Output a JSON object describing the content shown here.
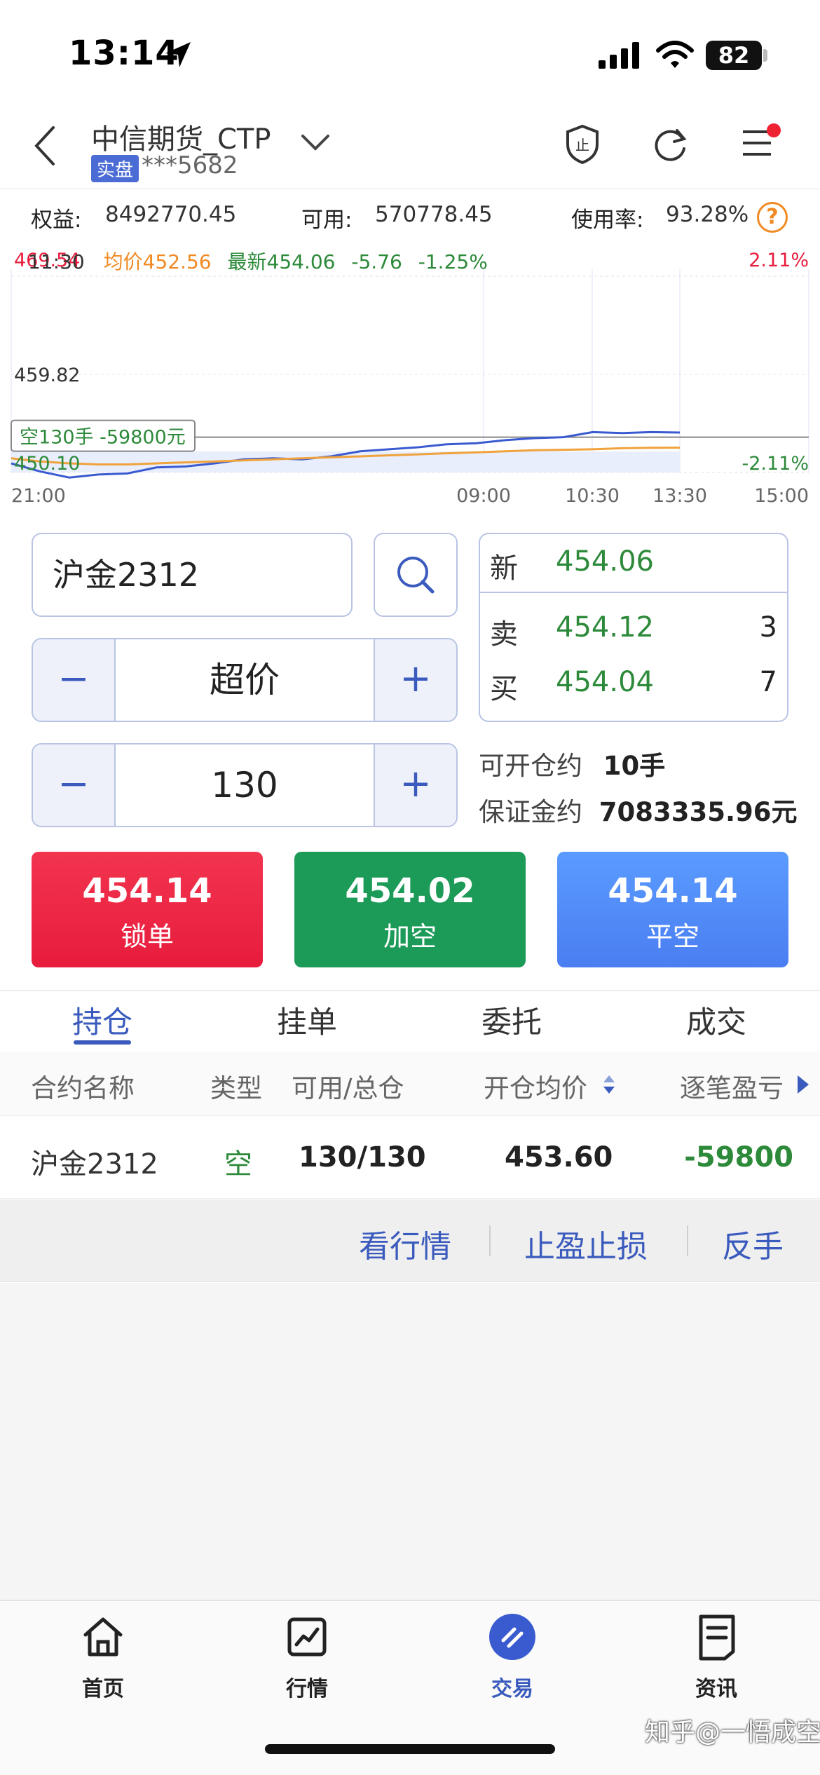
{
  "status_bar": {
    "time": "13:14",
    "battery": "82"
  },
  "header": {
    "account_name": "中信期货_CTP",
    "badge": "实盘",
    "account_no": "***5682"
  },
  "summary": {
    "equity_label": "权益:",
    "equity_value": "8492770.45",
    "available_label": "可用:",
    "available_value": "570778.45",
    "usage_label": "使用率:",
    "usage_value": "93.28%",
    "help": "?"
  },
  "chart": {
    "time": "11:30",
    "avg_label": "均价452.56",
    "last_label": "最新454.06",
    "change": "-5.76",
    "change_pct": "-1.25%",
    "y_high": "469.54",
    "y_mid": "459.82",
    "y_low": "450.10",
    "pct_high": "2.11%",
    "pct_low": "-2.11%",
    "position_tag": "空130手 -59800元",
    "x_ticks": [
      "21:00",
      "09:00",
      "10:30",
      "13:30",
      "15:00"
    ]
  },
  "chart_data": {
    "type": "line",
    "x_ticks": [
      "21:00",
      "09:00",
      "10:30",
      "13:30",
      "15:00"
    ],
    "ylim": [
      450.1,
      469.54
    ],
    "y_ticks": [
      469.54,
      459.82,
      450.1
    ],
    "percent_ticks": [
      "2.11%",
      "-2.11%"
    ],
    "reference_price": 453.6,
    "series": [
      {
        "name": "最新",
        "color": "#3a5bd0",
        "values": [
          451.0,
          450.2,
          449.6,
          449.9,
          450.0,
          450.6,
          450.7,
          451.0,
          451.4,
          451.5,
          451.4,
          451.7,
          452.2,
          452.4,
          452.6,
          452.9,
          453.0,
          453.3,
          453.5,
          453.6,
          454.1,
          454.0,
          454.1,
          454.06
        ]
      },
      {
        "name": "均价",
        "color": "#f0a23c",
        "values": [
          451.5,
          451.2,
          451.0,
          450.9,
          450.9,
          451.0,
          451.1,
          451.2,
          451.3,
          451.4,
          451.5,
          451.6,
          451.7,
          451.8,
          451.9,
          452.0,
          452.1,
          452.2,
          452.3,
          452.35,
          452.4,
          452.5,
          452.55,
          452.56
        ]
      }
    ]
  },
  "order": {
    "contract": "沪金2312",
    "price_type": "超价",
    "quantity": "130",
    "minus": "−",
    "plus": "+",
    "quote": {
      "last_label": "新",
      "last_value": "454.06",
      "ask_label": "卖",
      "ask_value": "454.12",
      "ask_vol": "3",
      "bid_label": "买",
      "bid_value": "454.04",
      "bid_vol": "7"
    },
    "open_label": "可开仓约",
    "open_value": "10手",
    "margin_label": "保证金约",
    "margin_value": "7083335.96元"
  },
  "actions": {
    "lock": {
      "price": "454.14",
      "label": "锁单"
    },
    "add_short": {
      "price": "454.02",
      "label": "加空"
    },
    "close_short": {
      "price": "454.14",
      "label": "平空"
    }
  },
  "tabs": [
    "持仓",
    "挂单",
    "委托",
    "成交"
  ],
  "table": {
    "headers": [
      "合约名称",
      "类型",
      "可用/总仓",
      "开仓均价",
      "逐笔盈亏"
    ],
    "row": {
      "contract": "沪金2312",
      "type": "空",
      "qty": "130/130",
      "avg_price": "453.60",
      "pnl": "-59800"
    }
  },
  "row_actions": [
    "看行情",
    "止盈止损",
    "反手"
  ],
  "bottom_nav": [
    "首页",
    "行情",
    "交易",
    "资讯"
  ],
  "watermark": "知乎@一悟成空",
  "colors": {
    "accent": "#3a5bbd",
    "up_red": "#e81c3d",
    "down_green": "#2d8a3a",
    "orange": "#f08a24"
  }
}
